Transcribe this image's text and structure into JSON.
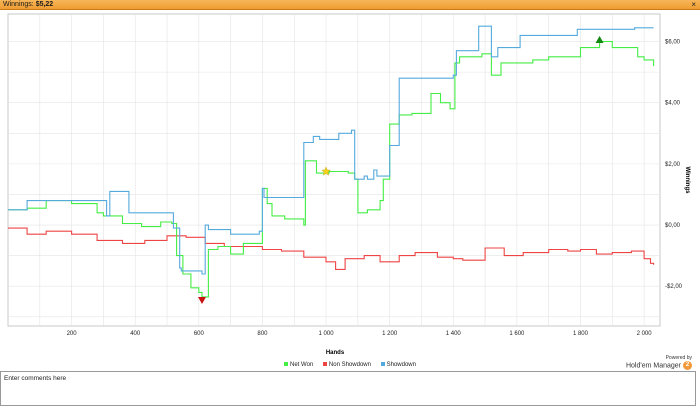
{
  "header": {
    "title_prefix": "Winnings:",
    "title_value": "$5,22",
    "close_label": "×"
  },
  "colors": {
    "net_won": "#44ee44",
    "non_showdown": "#ee4444",
    "showdown": "#55aadd",
    "grid": "#e4e4e4"
  },
  "chart_data": {
    "type": "line",
    "title": "",
    "xlabel": "Hands",
    "ylabel": "Winnings",
    "xlim": [
      0,
      2050
    ],
    "ylim": [
      -3.3,
      6.9
    ],
    "x_ticks": [
      200,
      400,
      600,
      800,
      1000,
      1200,
      1400,
      1600,
      1800,
      2000
    ],
    "x_tick_labels": [
      "200",
      "400",
      "600",
      "800",
      "1 000",
      "1 200",
      "1 400",
      "1 600",
      "1 800",
      "2 000"
    ],
    "y_ticks": [
      -2,
      0,
      2,
      4,
      6
    ],
    "y_tick_labels": [
      "-$2,00",
      "$0,00",
      "$2,00",
      "$4,00",
      "$6,00"
    ],
    "grid": true,
    "legend_position": "bottom",
    "series": [
      {
        "name": "Net Won",
        "x": [
          0,
          60,
          120,
          200,
          280,
          300,
          360,
          420,
          480,
          515,
          530,
          550,
          575,
          600,
          610,
          630,
          660,
          700,
          740,
          790,
          800,
          815,
          830,
          870,
          930,
          935,
          970,
          1010,
          1070,
          1090,
          1100,
          1130,
          1170,
          1180,
          1200,
          1230,
          1270,
          1330,
          1360,
          1390,
          1405,
          1420,
          1450,
          1490,
          1520,
          1550,
          1600,
          1650,
          1700,
          1760,
          1800,
          1830,
          1860,
          1900,
          1950,
          1980,
          2000,
          2030
        ],
        "values": [
          0.5,
          0.55,
          0.8,
          0.7,
          0.4,
          0.3,
          0.05,
          -0.05,
          0.1,
          0.05,
          -1.0,
          -1.6,
          -2.05,
          -2.2,
          -2.35,
          -0.8,
          -0.7,
          -0.95,
          -0.6,
          -0.6,
          1.2,
          0.7,
          0.3,
          0.2,
          0.0,
          2.1,
          1.7,
          1.75,
          1.7,
          1.5,
          0.4,
          0.5,
          0.8,
          1.5,
          3.3,
          3.6,
          3.65,
          4.3,
          4.0,
          3.8,
          5.3,
          5.5,
          5.5,
          5.6,
          4.9,
          5.3,
          5.3,
          5.4,
          5.5,
          5.5,
          5.8,
          5.8,
          6.0,
          5.8,
          5.8,
          5.5,
          5.4,
          5.2
        ]
      },
      {
        "name": "Non Showdown",
        "x": [
          0,
          60,
          120,
          200,
          280,
          360,
          430,
          500,
          560,
          620,
          680,
          760,
          800,
          860,
          930,
          1000,
          1030,
          1060,
          1120,
          1170,
          1230,
          1280,
          1350,
          1400,
          1430,
          1500,
          1560,
          1620,
          1700,
          1760,
          1800,
          1850,
          1900,
          1960,
          2000,
          2020,
          2030
        ],
        "values": [
          -0.1,
          -0.3,
          -0.2,
          -0.3,
          -0.5,
          -0.6,
          -0.5,
          -0.35,
          -0.4,
          -0.6,
          -0.7,
          -0.7,
          -0.8,
          -0.85,
          -1.05,
          -1.2,
          -1.45,
          -1.1,
          -1.0,
          -1.2,
          -1.0,
          -0.9,
          -1.05,
          -1.1,
          -1.15,
          -0.75,
          -1.0,
          -0.9,
          -0.8,
          -0.85,
          -0.8,
          -0.95,
          -0.9,
          -0.85,
          -1.1,
          -1.25,
          -1.3
        ]
      },
      {
        "name": "Showdown",
        "x": [
          0,
          60,
          300,
          310,
          320,
          380,
          510,
          520,
          530,
          540,
          545,
          600,
          610,
          620,
          630,
          690,
          700,
          790,
          800,
          805,
          880,
          920,
          930,
          950,
          960,
          980,
          1010,
          1030,
          1040,
          1070,
          1080,
          1090,
          1110,
          1120,
          1130,
          1150,
          1160,
          1190,
          1200,
          1230,
          1360,
          1400,
          1410,
          1420,
          1480,
          1490,
          1520,
          1540,
          1610,
          1760,
          1790,
          1960,
          1970,
          2030
        ],
        "values": [
          0.5,
          0.8,
          0.8,
          0.3,
          1.1,
          0.4,
          0.4,
          -0.1,
          -0.1,
          -1.4,
          -1.5,
          -1.5,
          -1.6,
          0.0,
          -0.15,
          -0.15,
          -0.3,
          -0.2,
          1.2,
          0.9,
          0.9,
          0.9,
          2.7,
          2.7,
          2.9,
          2.8,
          2.8,
          2.8,
          3.0,
          3.0,
          3.1,
          1.5,
          1.5,
          1.6,
          1.5,
          1.8,
          1.6,
          1.6,
          2.6,
          4.8,
          4.8,
          4.9,
          5.7,
          5.7,
          6.5,
          6.5,
          5.5,
          5.8,
          6.2,
          6.2,
          6.4,
          6.4,
          6.45,
          6.45
        ]
      }
    ],
    "markers": [
      {
        "type": "triangle-down",
        "color": "#cc1111",
        "x": 610,
        "y": -2.45
      },
      {
        "type": "star",
        "color": "#f2d21c",
        "x": 1000,
        "y": 1.75
      },
      {
        "type": "triangle-up",
        "color": "#118811",
        "x": 1860,
        "y": 6.05
      }
    ]
  },
  "legend": {
    "net_won": "Net Won",
    "non_showdown": "Non Showdown",
    "showdown": "Showdown"
  },
  "branding": {
    "powered_by": "Powered by",
    "product": "Hold'em Manager"
  },
  "comments": {
    "placeholder": "Enter comments here"
  }
}
